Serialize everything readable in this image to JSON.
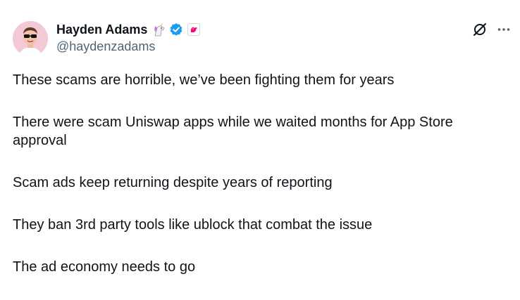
{
  "author": {
    "display_name": "Hayden Adams",
    "handle": "@haydenzadams",
    "emoji_icon": "unicorn-icon",
    "verified_icon": "verified-badge-icon",
    "affiliate_icon": "uniswap-affiliate-icon"
  },
  "actions": {
    "grok_icon": "grok-icon",
    "more_icon": "more-options-icon"
  },
  "tweet": {
    "paragraphs": [
      "These scams are horrible, we’ve been fighting them for years",
      "There were scam Uniswap apps while we waited months for App Store approval",
      "Scam ads keep returning despite years of reporting",
      "They ban 3rd party tools like ublock that combat the issue",
      "The ad economy needs to go"
    ]
  },
  "colors": {
    "text": "#0f1419",
    "secondary_text": "#536471",
    "verified_blue": "#1d9bf0",
    "avatar_bg": "#f3c9d6",
    "uniswap_pink": "#ff007a"
  }
}
